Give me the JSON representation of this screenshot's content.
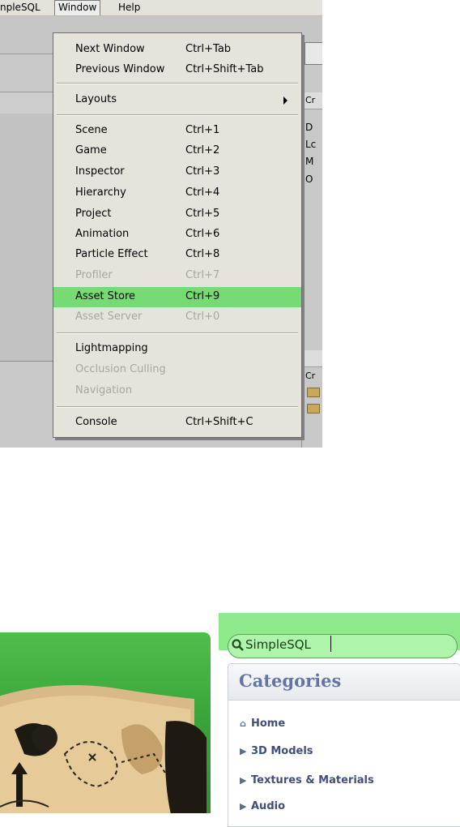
{
  "menubar": {
    "left_fragment": "npleSQL",
    "window_label": "Window",
    "help_label": "Help"
  },
  "right_pane": {
    "frag_cr1": "Cr",
    "frag_d": "D",
    "frag_l": "Lc",
    "frag_m": "M",
    "frag_o": "O",
    "frag_cr2": "Cr"
  },
  "window_menu": {
    "items": [
      {
        "label": "Next Window",
        "shortcut": "Ctrl+Tab",
        "enabled": true
      },
      {
        "label": "Previous Window",
        "shortcut": "Ctrl+Shift+Tab",
        "enabled": true
      },
      {
        "label": "Layouts",
        "shortcut": "",
        "submenu": true,
        "enabled": true
      },
      {
        "label": "Scene",
        "shortcut": "Ctrl+1",
        "enabled": true
      },
      {
        "label": "Game",
        "shortcut": "Ctrl+2",
        "enabled": true
      },
      {
        "label": "Inspector",
        "shortcut": "Ctrl+3",
        "enabled": true
      },
      {
        "label": "Hierarchy",
        "shortcut": "Ctrl+4",
        "enabled": true
      },
      {
        "label": "Project",
        "shortcut": "Ctrl+5",
        "enabled": true
      },
      {
        "label": "Animation",
        "shortcut": "Ctrl+6",
        "enabled": true
      },
      {
        "label": "Particle Effect",
        "shortcut": "Ctrl+8",
        "enabled": true
      },
      {
        "label": "Profiler",
        "shortcut": "Ctrl+7",
        "enabled": false
      },
      {
        "label": "Asset Store",
        "shortcut": "Ctrl+9",
        "enabled": true,
        "highlighted": true
      },
      {
        "label": "Asset Server",
        "shortcut": "Ctrl+0",
        "enabled": false
      },
      {
        "label": "Lightmapping",
        "shortcut": "",
        "enabled": true
      },
      {
        "label": "Occlusion Culling",
        "shortcut": "",
        "enabled": false
      },
      {
        "label": "Navigation",
        "shortcut": "",
        "enabled": false
      },
      {
        "label": "Console",
        "shortcut": "Ctrl+Shift+C",
        "enabled": true
      }
    ],
    "highlight_color": "#75db72"
  },
  "asset_store": {
    "search": {
      "value": "SimpleSQL"
    },
    "categories": {
      "title": "Categories",
      "items": [
        {
          "label": "Home",
          "icon": "home-icon"
        },
        {
          "label": "3D Models",
          "icon": "triangle-right-icon"
        },
        {
          "label": "Textures & Materials",
          "icon": "triangle-right-icon"
        },
        {
          "label": "Audio",
          "icon": "triangle-right-icon"
        }
      ]
    },
    "accent_color": "#8de98a",
    "category_text_color": "#3f4f7a"
  }
}
